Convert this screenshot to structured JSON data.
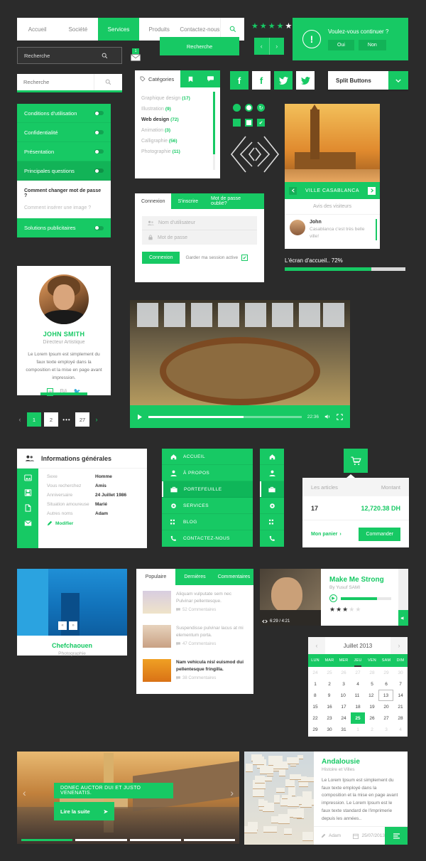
{
  "theme": {
    "accent": "#17c964",
    "accent_dark": "#12b357",
    "bg": "#2b2b2b"
  },
  "topnav": {
    "items": [
      {
        "label": "Accueil",
        "active": false
      },
      {
        "label": "Société",
        "active": false
      },
      {
        "label": "Services",
        "active": true
      },
      {
        "label": "Produits",
        "active": false
      },
      {
        "label": "Contactez-nous",
        "active": false
      }
    ],
    "search_icon": "search-icon"
  },
  "search_dark": {
    "value": "Recherche",
    "icon": "search-icon"
  },
  "search_light": {
    "placeholder": "Recherche",
    "icon": "search-icon"
  },
  "search_button": {
    "label": "Recherche"
  },
  "envelope": {
    "badge": "1",
    "icon": "envelope-icon"
  },
  "rating_top": {
    "filled": 4,
    "total": 5
  },
  "arrow_pager": {
    "prev": "‹",
    "next": "›"
  },
  "modal": {
    "question": "Voulez-vous continuer ?",
    "yes": "Oui",
    "no": "Non",
    "icon": "exclamation-circle-icon"
  },
  "accordion": {
    "items": [
      {
        "label": "Conditions d'utilisation",
        "selected": false,
        "toggle": "off"
      },
      {
        "label": "Confidentialité",
        "selected": false,
        "toggle": "off"
      },
      {
        "label": "Présentation",
        "selected": false,
        "toggle": "off"
      },
      {
        "label": "Principales questions",
        "selected": true,
        "toggle": "on"
      }
    ],
    "sub_items": [
      {
        "label": "Comment changer mot de passe ?",
        "active": true
      },
      {
        "label": "Comment insérer une image ?",
        "active": false
      }
    ],
    "last": {
      "label": "Solutions publicitaires",
      "toggle": "off"
    }
  },
  "categories": {
    "title": "Catégories",
    "title_icon": "tag-icon",
    "tab_icons": [
      "bookmark-icon",
      "comment-icon"
    ],
    "items": [
      {
        "label": "Graphique design",
        "count": "(17)",
        "active": false
      },
      {
        "label": "Illustration",
        "count": "(9)",
        "active": false
      },
      {
        "label": "Web design",
        "count": "(72)",
        "active": true
      },
      {
        "label": "Animation",
        "count": "(3)",
        "active": false
      },
      {
        "label": "Calligraphie",
        "count": "(56)",
        "active": false
      },
      {
        "label": "Photographie",
        "count": "(11)",
        "active": false
      }
    ]
  },
  "login": {
    "tabs": [
      {
        "label": "Connexion",
        "active": true
      },
      {
        "label": "S'inscrire",
        "active": false
      },
      {
        "label": "Mot de passe oublié?",
        "active": false
      }
    ],
    "username_placeholder": "Nom d'utilisateur",
    "password_placeholder": "Mot de passe",
    "username_icon": "users-icon",
    "password_icon": "lock-icon",
    "submit": "Connexion",
    "remember": "Garder ma session active",
    "checkbox_icon": "check-icon"
  },
  "profile": {
    "name": "JOHN SMITH",
    "role": "Directeur Artistique",
    "bio": "Le Lorem Ipsum est simplement du faux texte employé dans la composition et la mise en page avant impression.",
    "socials": [
      {
        "name": "instagram-icon",
        "glyph": "◙",
        "active": true
      },
      {
        "name": "behance-icon",
        "glyph": "Bē",
        "active": false
      },
      {
        "name": "twitter-icon",
        "glyph": "✦",
        "active": false
      }
    ]
  },
  "pagination": {
    "prev": "‹",
    "next": "›",
    "dots": "•••",
    "pages": [
      {
        "label": "1",
        "active": true
      },
      {
        "label": "2",
        "active": false
      },
      {
        "label": "27",
        "active": false
      }
    ]
  },
  "casablanca": {
    "title": "VILLE CASABLANCA",
    "prev_icon": "chevron-left-icon",
    "next_icon": "chevron-right-icon",
    "reviews_title": "Avis des visiteurs",
    "review": {
      "author": "John",
      "text": "Casablanca c'est très belle ville!"
    }
  },
  "progress": {
    "label": "L'écran d'accueil.. 72%",
    "percent": 72
  },
  "social_buttons": [
    {
      "name": "facebook-icon",
      "glyph": "f",
      "style": "green"
    },
    {
      "name": "facebook-icon",
      "glyph": "f",
      "style": "white"
    },
    {
      "name": "twitter-icon",
      "glyph": "🐦",
      "style": "green"
    },
    {
      "name": "twitter-icon",
      "glyph": "🐦",
      "style": "white"
    }
  ],
  "split_button": {
    "label": "Split Buttons",
    "caret": "⌄"
  },
  "controls": {
    "radios": [
      "radio-filled-icon",
      "radio-outline-icon",
      "radio-refresh-icon"
    ],
    "checkboxes": [
      "checkbox-filled-icon",
      "checkbox-outline-icon",
      "checkbox-checked-icon"
    ]
  },
  "chevron_ornament": {
    "name": "diamond-chevrons-icon"
  },
  "video": {
    "play_icon": "play-icon",
    "time": "22:36",
    "progress_percent": 62,
    "volume_icon": "volume-icon",
    "fullscreen_icon": "fullscreen-icon"
  },
  "infos": {
    "title": "Informations générales",
    "title_icon": "users-icon",
    "side_icons": [
      "image-icon",
      "save-icon",
      "file-icon",
      "mail-icon"
    ],
    "fields": [
      {
        "key": "Sexe",
        "value": "Homme"
      },
      {
        "key": "Vous recherchez",
        "value": "Amis"
      },
      {
        "key": "Anniversaire",
        "value": "24 Juillet 1986"
      },
      {
        "key": "Situation amoureuse",
        "value": "Marié"
      },
      {
        "key": "Autres noms",
        "value": "Adam"
      }
    ],
    "edit": "Modifier",
    "edit_icon": "pencil-icon"
  },
  "vnav": {
    "items": [
      {
        "label": "ACCUEIL",
        "icon": "home-icon",
        "active": false
      },
      {
        "label": "À PROPOS",
        "icon": "user-icon",
        "active": false
      },
      {
        "label": "PORTEFEUILLE",
        "icon": "briefcase-icon",
        "active": true
      },
      {
        "label": "SERVICES",
        "icon": "gear-icon",
        "active": false
      },
      {
        "label": "BLOG",
        "icon": "list-icon",
        "active": false
      },
      {
        "label": "CONTACTEZ-NOUS",
        "icon": "phone-icon",
        "active": false
      }
    ]
  },
  "cart": {
    "button_icon": "cart-icon",
    "col_items": "Les articles",
    "col_amount": "Montant",
    "quantity": "17",
    "amount": "12,720.38 DH",
    "my_cart": "Mon panier",
    "my_cart_caret": "›",
    "order": "Commander"
  },
  "chefchaouen": {
    "title": "Chefchaouen",
    "subtitle": "Photographie",
    "prev": "«",
    "next": "»"
  },
  "posts": {
    "tabs": [
      {
        "label": "Populaire",
        "active": true
      },
      {
        "label": "Dernières",
        "active": false
      },
      {
        "label": "Commentaires",
        "active": false
      }
    ],
    "items": [
      {
        "text": "Aliquam vulputate sem nec Pulvinar pellentesque.",
        "comments": "52 Commentaires",
        "active": false
      },
      {
        "text": "Suspendisse pulvinar lacus at mi elementum porta.",
        "comments": "47 Commentaires",
        "active": false
      },
      {
        "text": "Nam vehicula nisl euismod dui pellentesque fringilla.",
        "comments": "38 Commentaires",
        "active": true
      }
    ],
    "comment_icon": "comment-icon"
  },
  "music": {
    "title": "Make Me Strong",
    "artist": "By Yusuf SAMI",
    "time": "6:29 / 4:21",
    "progress_percent": 72,
    "stars_filled": 3,
    "stars_total": 5,
    "play_icon": "play-circle-icon",
    "volume_icon": "volume-icon",
    "expand_icon": "expand-icon"
  },
  "calendar": {
    "month": "Juillet 2013",
    "prev": "‹",
    "next": "›",
    "dow": [
      "LUN",
      "MAR",
      "MER",
      "JEU",
      "VEN",
      "SAM",
      "DIM"
    ],
    "dow_active_index": 3,
    "weeks": [
      [
        {
          "d": "24",
          "m": true
        },
        {
          "d": "25",
          "m": true
        },
        {
          "d": "26",
          "m": true
        },
        {
          "d": "27",
          "m": true
        },
        {
          "d": "28",
          "m": true
        },
        {
          "d": "29",
          "m": true
        },
        {
          "d": "30",
          "m": true
        }
      ],
      [
        {
          "d": "1"
        },
        {
          "d": "2"
        },
        {
          "d": "3"
        },
        {
          "d": "4"
        },
        {
          "d": "5"
        },
        {
          "d": "6"
        },
        {
          "d": "7"
        }
      ],
      [
        {
          "d": "8"
        },
        {
          "d": "9"
        },
        {
          "d": "10"
        },
        {
          "d": "11"
        },
        {
          "d": "12"
        },
        {
          "d": "13",
          "o": true
        },
        {
          "d": "14"
        }
      ],
      [
        {
          "d": "15"
        },
        {
          "d": "16"
        },
        {
          "d": "17"
        },
        {
          "d": "18"
        },
        {
          "d": "19"
        },
        {
          "d": "20"
        },
        {
          "d": "21"
        }
      ],
      [
        {
          "d": "22"
        },
        {
          "d": "23"
        },
        {
          "d": "24"
        },
        {
          "d": "25",
          "s": true
        },
        {
          "d": "26"
        },
        {
          "d": "27"
        },
        {
          "d": "28"
        }
      ],
      [
        {
          "d": "29"
        },
        {
          "d": "30"
        },
        {
          "d": "31"
        },
        {
          "d": "1",
          "m": true
        },
        {
          "d": "2",
          "m": true
        },
        {
          "d": "3",
          "m": true
        },
        {
          "d": "4",
          "m": true
        }
      ]
    ]
  },
  "hero": {
    "caption": "DONEC AUCTOR DUI ET JUSTO VENENATIS.",
    "button": "Lire la suite",
    "button_arrow": "➤",
    "prev": "‹",
    "next": "›",
    "slides": 4,
    "active_slide": 1
  },
  "andalousie": {
    "title": "Andalousie",
    "subtitle": "Histoire et Villes",
    "body": "Le Lorem Ipsum est simplement du faux texte employé dans la composition et la mise en page avant impression. Le Lorem Ipsum est le faux texte standard de l'imprimerie depuis les années..",
    "author": "Adam",
    "author_icon": "pencil-icon",
    "date": "25/07/2013",
    "date_icon": "calendar-icon",
    "menu_icon": "list-icon"
  }
}
